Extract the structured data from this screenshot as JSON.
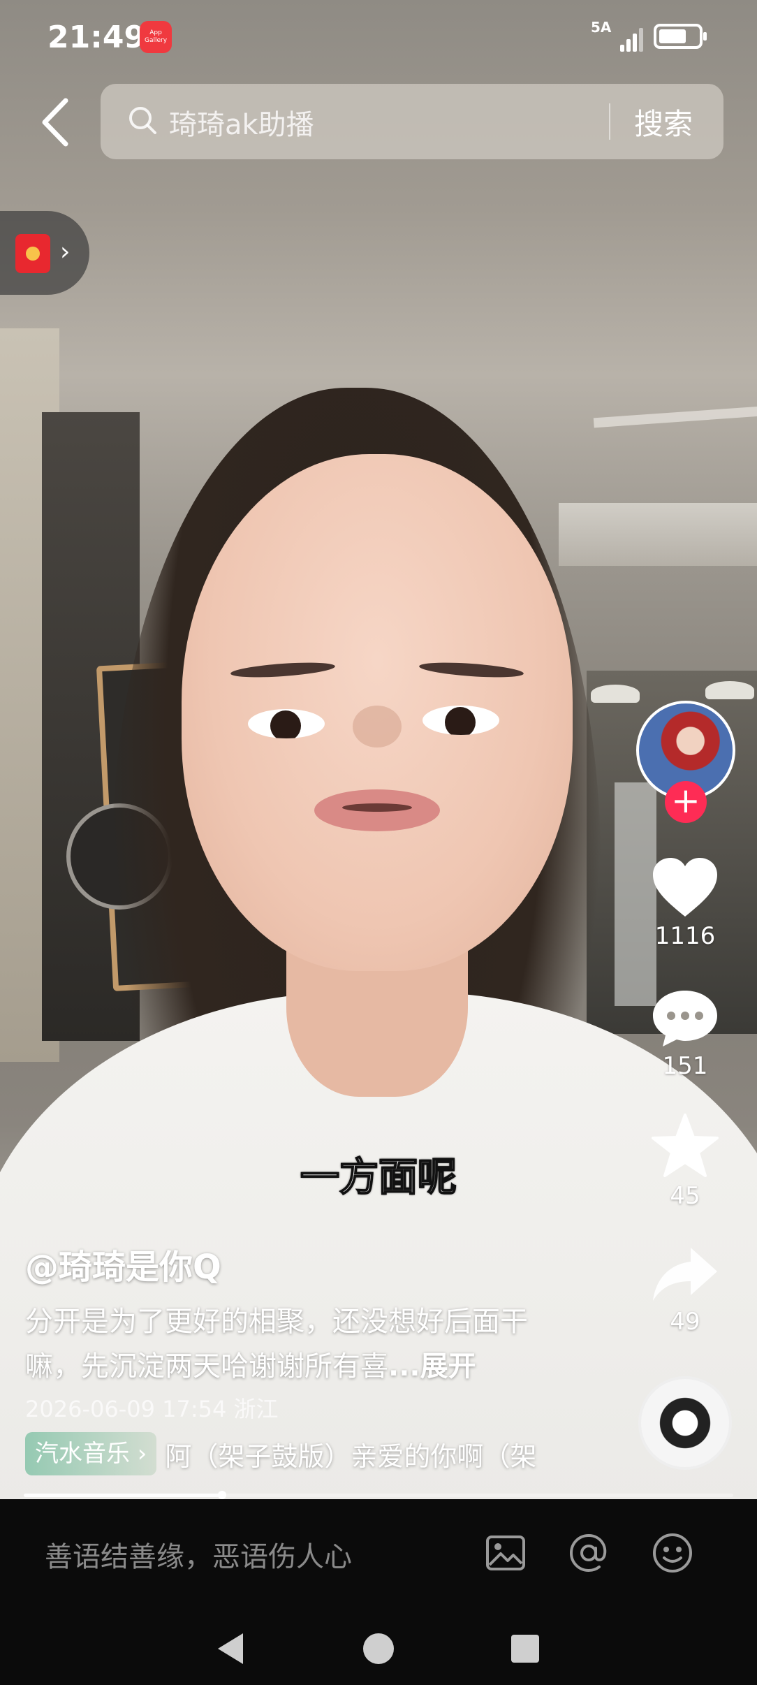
{
  "status_bar": {
    "time": "21:49",
    "app_badge": "App Gallery",
    "network": "5A",
    "battery_level": 0.7
  },
  "search": {
    "placeholder": "琦琦ak助播",
    "button_label": "搜索"
  },
  "overlay": {
    "subtitle": "一方面呢"
  },
  "rail": {
    "likes": "1116",
    "comments": "151",
    "favorites": "45",
    "shares": "49",
    "follow_symbol": "+"
  },
  "post": {
    "author": "@琦琦是你Q",
    "description": "分开是为了更好的相聚，还没想好后面干嘛，先沉淀两天哈谢谢所有喜",
    "expand_label": "...展开",
    "meta": "2026-06-09 17:54 浙江",
    "music_tag": "汽水音乐 ›",
    "music_title": "阿（架子鼓版）亲爱的你啊（架"
  },
  "playback": {
    "progress": 0.28
  },
  "comment_bar": {
    "placeholder": "善语结善缘，恶语伤人心"
  },
  "colors": {
    "follow_accent": "#fe2c55",
    "packet_red": "#e8282f"
  },
  "icons": [
    "back-arrow-icon",
    "search-icon",
    "red-packet-icon",
    "heart-icon",
    "comment-icon",
    "star-icon",
    "share-icon",
    "image-icon",
    "at-icon",
    "emoji-icon"
  ]
}
